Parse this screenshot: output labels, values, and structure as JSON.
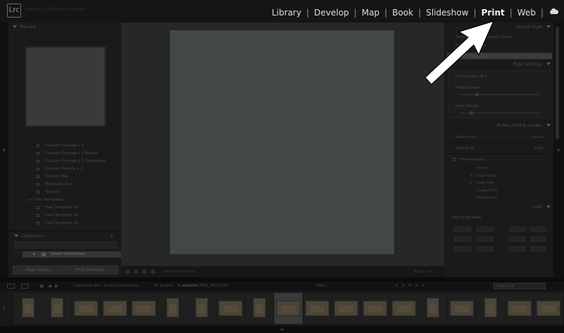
{
  "app": {
    "logo_text": "Lrc",
    "title": "Adobe Lightroom Classic"
  },
  "modules": {
    "library": "Library",
    "develop": "Develop",
    "map": "Map",
    "book": "Book",
    "slideshow": "Slideshow",
    "print": "Print",
    "web": "Web",
    "active": "Print",
    "separator": "|"
  },
  "left_panel": {
    "preview_label": "Preview",
    "templates": [
      {
        "label": "Custom Overlap x 3",
        "type": "item"
      },
      {
        "label": "Custom Overlap x 3 Border",
        "type": "item"
      },
      {
        "label": "Custom Overlap x 3 Landscape",
        "type": "item"
      },
      {
        "label": "Custom Square + 2",
        "type": "item"
      },
      {
        "label": "Fine Art Mat",
        "type": "item"
      },
      {
        "label": "Maximize Size",
        "type": "item"
      },
      {
        "label": "Triptych",
        "type": "item"
      },
      {
        "label": "User Templates",
        "type": "folder"
      },
      {
        "label": "Free Template 01",
        "type": "item"
      },
      {
        "label": "Free Template 02",
        "type": "item"
      },
      {
        "label": "Free Template 03",
        "type": "item"
      }
    ],
    "collections_label": "Collections",
    "collections_plus": "+",
    "smart_collections": "Smart Collections",
    "page_setup": "Page Setup...",
    "print_settings": "Print Settings..."
  },
  "right_panel": {
    "layout_style": "Layout Style",
    "layout_option_1": "Single Image / Contact Sheet",
    "layout_option_2": "Picture Package",
    "layout_option_3": "Custom Package",
    "page_settings": "Page Settings",
    "page_settings_rows": [
      "Dimensions: 8.5",
      "Photo Border",
      "Inner Stroke"
    ],
    "rulers": "Rulers, Grid & Guides",
    "ruler_units_label": "Ruler Units",
    "ruler_units_value": "Inches",
    "grid_snap_label": "Grid Snap",
    "grid_snap_value": "Cells",
    "show_guides": "Show Guides",
    "guide_options": [
      "Rulers",
      "Page Bleed",
      "Page Grid",
      "Image Cells",
      "Dimensions"
    ],
    "cells": "Cells",
    "add_to_package": "Add to Package"
  },
  "center": {
    "toolbar_status": "Selected Photos",
    "toolbar_right": "Page 1 of 1"
  },
  "filmstrip_bar": {
    "collection_set": "Collection Set : Smart Collections",
    "photo_count": "32 photos",
    "selected_text": "1 selected",
    "file_name": "/IMG_0623.CR2",
    "filter_label": "Filter :",
    "filter_value": "Filters Off",
    "stars": "★ ★ ★ ★ ★"
  },
  "filmstrip": {
    "thumbnails": [
      {
        "orientation": "portrait",
        "selected": false
      },
      {
        "orientation": "portrait",
        "selected": false
      },
      {
        "orientation": "landscape",
        "selected": false
      },
      {
        "orientation": "landscape",
        "selected": false
      },
      {
        "orientation": "landscape",
        "selected": false
      },
      {
        "orientation": "portrait",
        "selected": false
      },
      {
        "orientation": "portrait",
        "selected": false
      },
      {
        "orientation": "landscape",
        "selected": false
      },
      {
        "orientation": "portrait",
        "selected": false
      },
      {
        "orientation": "landscape",
        "selected": true
      },
      {
        "orientation": "landscape",
        "selected": false
      },
      {
        "orientation": "landscape",
        "selected": false
      },
      {
        "orientation": "landscape",
        "selected": false
      },
      {
        "orientation": "landscape",
        "selected": false
      },
      {
        "orientation": "portrait",
        "selected": false
      },
      {
        "orientation": "landscape",
        "selected": false
      },
      {
        "orientation": "portrait",
        "selected": false
      },
      {
        "orientation": "landscape",
        "selected": false
      },
      {
        "orientation": "landscape",
        "selected": false
      }
    ]
  },
  "icons": {
    "cloud": "cloud-icon",
    "arrow": "annotation-arrow-icon"
  },
  "colors": {
    "annotation_arrow": "#ffffff",
    "module_text": "#dedede"
  }
}
